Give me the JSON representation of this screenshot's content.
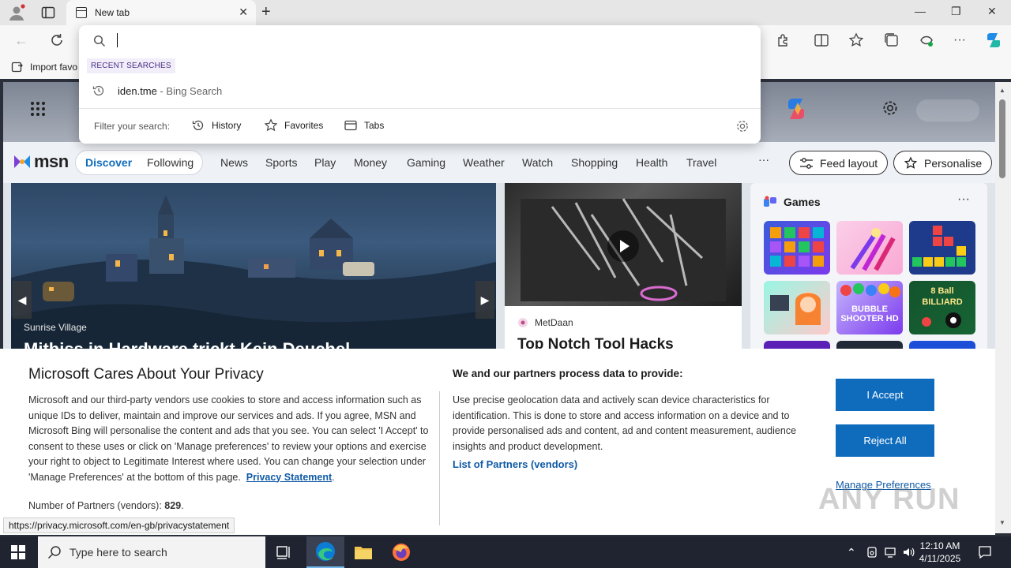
{
  "browser": {
    "tab_title": "New tab",
    "favorites_bar": {
      "import_label": "Import favo"
    }
  },
  "omnibox": {
    "input_value": "",
    "recent_header": "RECENT SEARCHES",
    "recent": [
      {
        "query": "iden.tme",
        "source": " - Bing Search"
      }
    ],
    "filter_label": "Filter your search:",
    "filters": [
      "History",
      "Favorites",
      "Tabs"
    ]
  },
  "msn": {
    "logo": "msn",
    "nav": [
      "Discover",
      "Following",
      "News",
      "Sports",
      "Play",
      "Money",
      "Gaming",
      "Weather",
      "Watch",
      "Shopping",
      "Health",
      "Travel"
    ],
    "nav_more": "···",
    "feed_layout": "Feed layout",
    "personalise": "Personalise",
    "hero": {
      "caption": "Sunrise Village",
      "title": "Mitbiss in Hardware trickt Kein Deuchel"
    },
    "video": {
      "source": "MetDaan",
      "title": "Top Notch Tool Hacks"
    },
    "games": {
      "title": "Games",
      "more": "···",
      "tiles": [
        "BUBBLE SHOOTER HD",
        "8 Ball BILLIARD"
      ]
    }
  },
  "privacy": {
    "title": "Microsoft Cares About Your Privacy",
    "body": "Microsoft and our third-party vendors use cookies to store and access information such as unique IDs to deliver, maintain and improve our services and ads. If you agree, MSN and Microsoft Bing will personalise the content and ads that you see. You can select 'I Accept' to consent to these uses or click on 'Manage preferences' to review your options and exercise your right to object to Legitimate Interest where used.  You can change your selection under 'Manage Preferences' at the bottom of this page.",
    "privacy_link": "Privacy Statement",
    "partners_label": "Number of Partners (vendors): ",
    "partners_count": "829",
    "purpose_title": "We and our partners process data to provide:",
    "purpose_body": "Use precise geolocation data and actively scan device characteristics for identification. This is done to store and access information on a device and to provide personalised ads and content, ad and content measurement, audience insights and product development.",
    "vendors_link": "List of Partners (vendors)",
    "accept": "I Accept",
    "reject": "Reject All",
    "manage": "Manage Preferences"
  },
  "status_url": "https://privacy.microsoft.com/en-gb/privacystatement",
  "watermark": "ANY RUN",
  "taskbar": {
    "search_placeholder": "Type here to search",
    "time": "12:10 AM",
    "date": "4/11/2025"
  }
}
